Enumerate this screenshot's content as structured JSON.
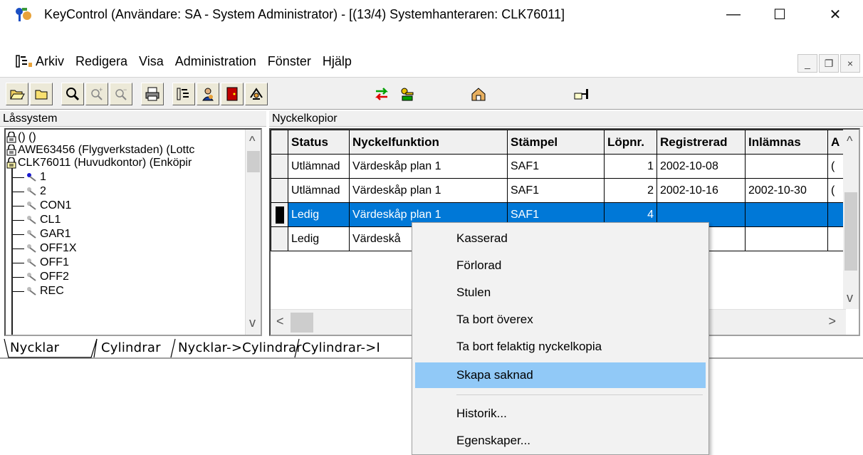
{
  "window": {
    "title": "KeyControl   (Användare: SA - System Administrator) - [(13/4) Systemhanteraren: CLK76011]",
    "minimize": "—",
    "maximize": "☐",
    "close": "✕"
  },
  "menu": {
    "items": [
      "Arkiv",
      "Redigera",
      "Visa",
      "Administration",
      "Fönster",
      "Hjälp"
    ],
    "mdi_min": "_",
    "mdi_restore": "❐",
    "mdi_close": "×"
  },
  "toolbar": {
    "icons": [
      "open-folder-icon",
      "folder-icon",
      "zoom-icon",
      "zoom-in-icon",
      "zoom-out-icon",
      "print-icon",
      "tree-view-icon",
      "user-icon",
      "door-icon",
      "key-ring-icon",
      "transfer-icon",
      "keys-icon",
      "home-icon",
      "pointer-hand-icon"
    ]
  },
  "left_pane": {
    "header": "Låssystem",
    "root_nodes": [
      "() ()",
      "AWE63456 (Flygverkstaden) (Lottc",
      "CLK76011 (Huvudkontor) (Enköpir"
    ],
    "keys": [
      "1",
      "2",
      "CON1",
      "CL1",
      "GAR1",
      "OFF1X",
      "OFF1",
      "OFF2",
      "REC"
    ]
  },
  "right_pane": {
    "header": "Nyckelkopior",
    "columns": [
      "Status",
      "Nyckelfunktion",
      "Stämpel",
      "Löpnr.",
      "Registrerad",
      "Inlämnas",
      "A"
    ],
    "rows": [
      {
        "status": "Utlämnad",
        "funktion": "Värdeskåp plan 1",
        "stampel": "SAF1",
        "lopnr": "1",
        "registrerad": "2002-10-08",
        "inlamnas": "",
        "a": "("
      },
      {
        "status": "Utlämnad",
        "funktion": "Värdeskåp plan 1",
        "stampel": "SAF1",
        "lopnr": "2",
        "registrerad": "2002-10-16",
        "inlamnas": "2002-10-30",
        "a": "("
      },
      {
        "status": "Ledig",
        "funktion": "Värdeskåp plan 1",
        "stampel": "SAF1",
        "lopnr": "4",
        "registrerad": "",
        "inlamnas": "",
        "a": ""
      },
      {
        "status": "Ledig",
        "funktion": "Värdeskå",
        "stampel": "",
        "lopnr": "",
        "registrerad": "",
        "inlamnas": "",
        "a": ""
      }
    ]
  },
  "tabs": [
    "Nycklar",
    "Cylindrar",
    "Nycklar->Cylindrar",
    "Cylindrar->I"
  ],
  "context_menu": {
    "items": [
      "Kasserad",
      "Förlorad",
      "Stulen",
      "Ta bort överex",
      "Ta bort felaktig nyckelkopia",
      "Skapa saknad",
      "Historik...",
      "Egenskaper..."
    ],
    "highlighted": "Skapa saknad"
  },
  "colors": {
    "selection": "#0078d7",
    "menu_highlight": "#91c9f7"
  }
}
